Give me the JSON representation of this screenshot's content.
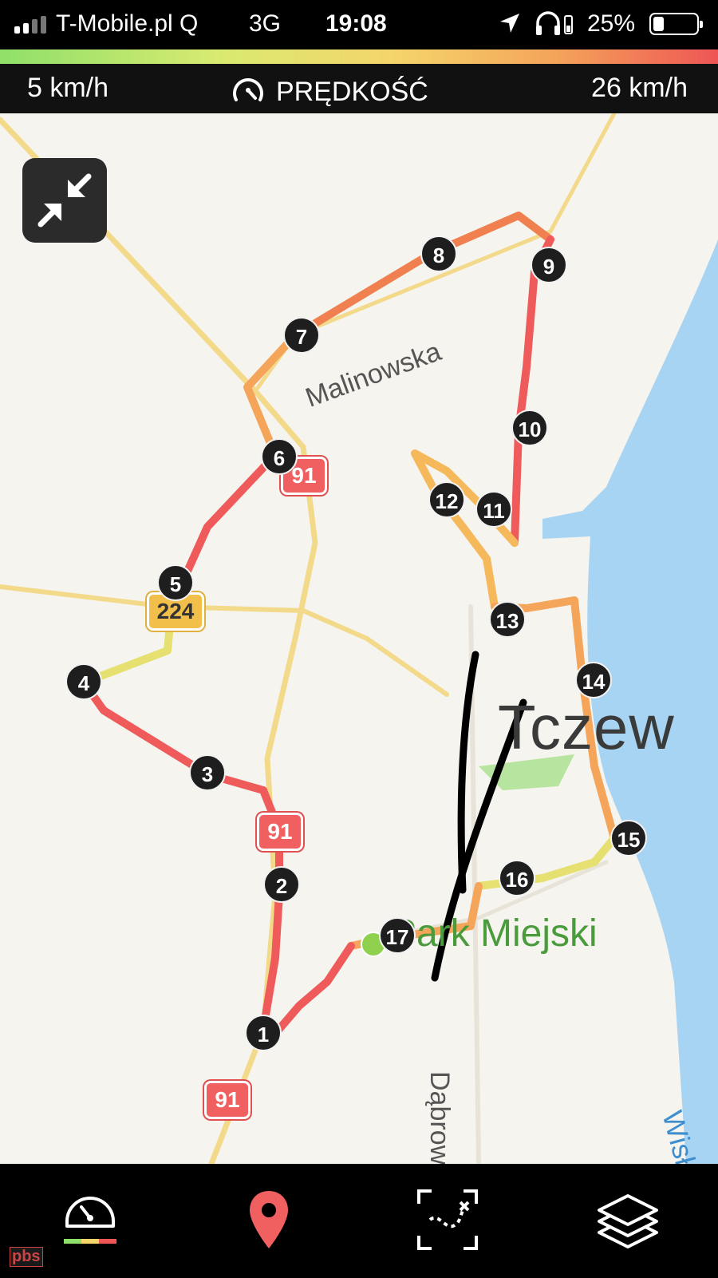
{
  "status_bar": {
    "carrier": "T-Mobile.pl Q",
    "network": "3G",
    "time": "19:08",
    "battery": "25%",
    "battery_level_pct": 25,
    "icons": [
      "signal-icon",
      "location-arrow-icon",
      "headphones-icon",
      "battery-icon"
    ]
  },
  "speed_header": {
    "min": "5 km/h",
    "title": "PRĘDKOŚĆ",
    "max": "26 km/h",
    "icon": "speedometer-icon",
    "gradient_colors": [
      "#8fe06a",
      "#d8ea70",
      "#f5d56a",
      "#f4a25a",
      "#ee5555"
    ]
  },
  "map": {
    "city": "Tczew",
    "park": "Park Miejski",
    "streets": [
      "Malinowska",
      "Dąbrowska"
    ],
    "river": "Wisła",
    "road_badges": [
      {
        "label": "91",
        "color": "red"
      },
      {
        "label": "91",
        "color": "red"
      },
      {
        "label": "91",
        "color": "red"
      },
      {
        "label": "224",
        "color": "yellow"
      }
    ],
    "route_markers": [
      "1",
      "2",
      "3",
      "4",
      "5",
      "6",
      "7",
      "8",
      "9",
      "10",
      "11",
      "12",
      "13",
      "14",
      "15",
      "16",
      "17"
    ],
    "collapse_button_icon": "collapse-arrows-icon"
  },
  "toolbar": {
    "items": [
      {
        "icon": "speedometer-icon",
        "active": true
      },
      {
        "icon": "map-pin-icon",
        "active": false
      },
      {
        "icon": "route-fit-icon",
        "active": false
      },
      {
        "icon": "layers-icon",
        "active": false
      }
    ]
  },
  "watermark": "pbs"
}
